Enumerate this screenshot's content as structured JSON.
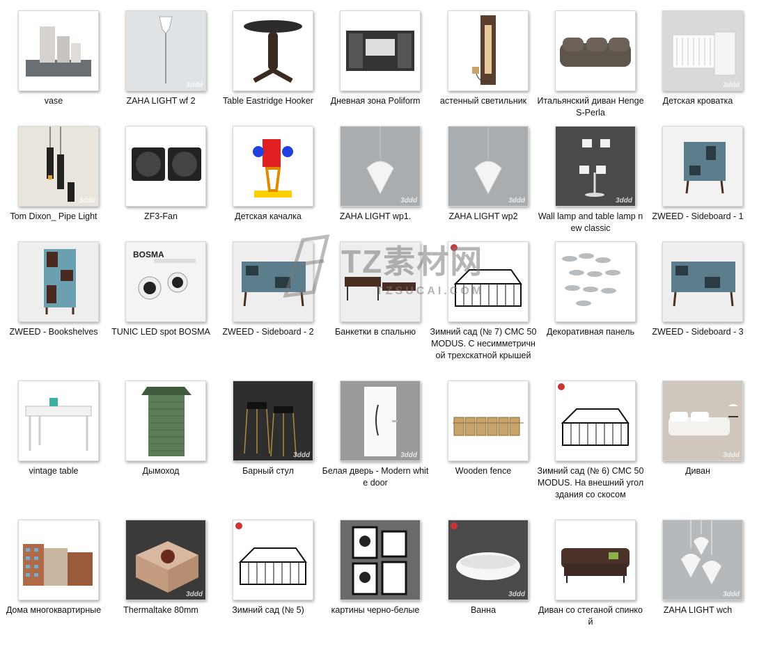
{
  "watermark": {
    "main": "TZ素材网",
    "sub": "TZSUCAI.COM"
  },
  "thumb_watermark": "3ddd",
  "items": [
    {
      "label": "vase",
      "icon": "vase-thumbnail",
      "bg": "#ffffff"
    },
    {
      "label": "ZAHA LIGHT wf 2",
      "icon": "floor-lamp-thumbnail",
      "bg": "#dfe3e6"
    },
    {
      "label": "Table Eastridge Hooker",
      "icon": "round-table-thumbnail",
      "bg": "#ffffff"
    },
    {
      "label": "Дневная зона Poliform",
      "icon": "wall-unit-thumbnail",
      "bg": "#ffffff"
    },
    {
      "label": "астенный светильник",
      "icon": "wall-light-thumbnail",
      "bg": "#ffffff"
    },
    {
      "label": "Итальянский диван Henge S-Perla",
      "icon": "sofa-thumbnail",
      "bg": "#ffffff"
    },
    {
      "label": "Детская кроватка",
      "icon": "crib-thumbnail",
      "bg": "#d9d9d9"
    },
    {
      "label": "Tom Dixon_ Pipe Light",
      "icon": "pendant-pipe-thumbnail",
      "bg": "#e9e5dc"
    },
    {
      "label": "ZF3-Fan",
      "icon": "fan-thumbnail",
      "bg": "#ffffff"
    },
    {
      "label": "Детская качалка",
      "icon": "spring-rider-thumbnail",
      "bg": "#ffffff"
    },
    {
      "label": "ZAHA LIGHT wp1.",
      "icon": "pendant-lamp-thumbnail",
      "bg": "#a9adb0"
    },
    {
      "label": "ZAHA LIGHT wp2",
      "icon": "pendant-lamp-thumbnail",
      "bg": "#a9adb0"
    },
    {
      "label": "Wall lamp and table lamp new classic",
      "icon": "classic-lamp-thumbnail",
      "bg": "#4a4a4a"
    },
    {
      "label": "ZWEED - Sideboard - 1",
      "icon": "sideboard-tall-thumbnail",
      "bg": "#f2f2f2"
    },
    {
      "label": "ZWEED - Bookshelves",
      "icon": "bookshelf-thumbnail",
      "bg": "#eeeeee"
    },
    {
      "label": "TUNIC LED spot BOSMA",
      "icon": "led-spot-thumbnail",
      "bg": "#f4f4f4"
    },
    {
      "label": "ZWEED - Sideboard - 2",
      "icon": "sideboard-wide-thumbnail",
      "bg": "#eeeeee"
    },
    {
      "label": "Банкетки в спальню",
      "icon": "bench-thumbnail",
      "bg": "#eeeeee"
    },
    {
      "label": "Зимний сад (№ 7) CMC 50 MODUS. С несимметричной трехскатной крышей",
      "icon": "greenhouse-thumbnail",
      "bg": "#ffffff"
    },
    {
      "label": "Декоративная панель",
      "icon": "fish-panel-thumbnail",
      "bg": "#ffffff"
    },
    {
      "label": "ZWEED - Sideboard - 3",
      "icon": "sideboard-wide-thumbnail",
      "bg": "#eeeeee"
    },
    {
      "label": "vintage table",
      "icon": "vintage-table-thumbnail",
      "bg": "#ffffff"
    },
    {
      "label": "Дымоход",
      "icon": "chimney-thumbnail",
      "bg": "#ffffff"
    },
    {
      "label": "Барный стул",
      "icon": "bar-stool-thumbnail",
      "bg": "#2e2e2e"
    },
    {
      "label": "Белая дверь - Modern white door",
      "icon": "door-thumbnail",
      "bg": "#9a9a9a"
    },
    {
      "label": "Wooden fence",
      "icon": "fence-thumbnail",
      "bg": "#ffffff"
    },
    {
      "label": "Зимний сад (№ 6) CMC 50 MODUS. На внешний угол здания со скосом",
      "icon": "greenhouse-thumbnail",
      "bg": "#ffffff"
    },
    {
      "label": "Диван",
      "icon": "white-sofa-thumbnail",
      "bg": "#cfc7bd"
    },
    {
      "label": "Дома многоквартирные",
      "icon": "building-thumbnail",
      "bg": "#ffffff"
    },
    {
      "label": "Thermaltake 80mm",
      "icon": "fan-box-thumbnail",
      "bg": "#3a3a3a"
    },
    {
      "label": "Зимний сад (№ 5)",
      "icon": "greenhouse-thumbnail",
      "bg": "#ffffff"
    },
    {
      "label": "картины черно-белые",
      "icon": "pictures-thumbnail",
      "bg": "#6a6a6a"
    },
    {
      "label": "Ванна",
      "icon": "bathtub-thumbnail",
      "bg": "#4a4a4a"
    },
    {
      "label": "Диван со стеганой спинкой",
      "icon": "tufted-sofa-thumbnail",
      "bg": "#ffffff"
    },
    {
      "label": "ZAHA LIGHT wch",
      "icon": "chandelier-thumbnail",
      "bg": "#b5b9bc"
    }
  ]
}
